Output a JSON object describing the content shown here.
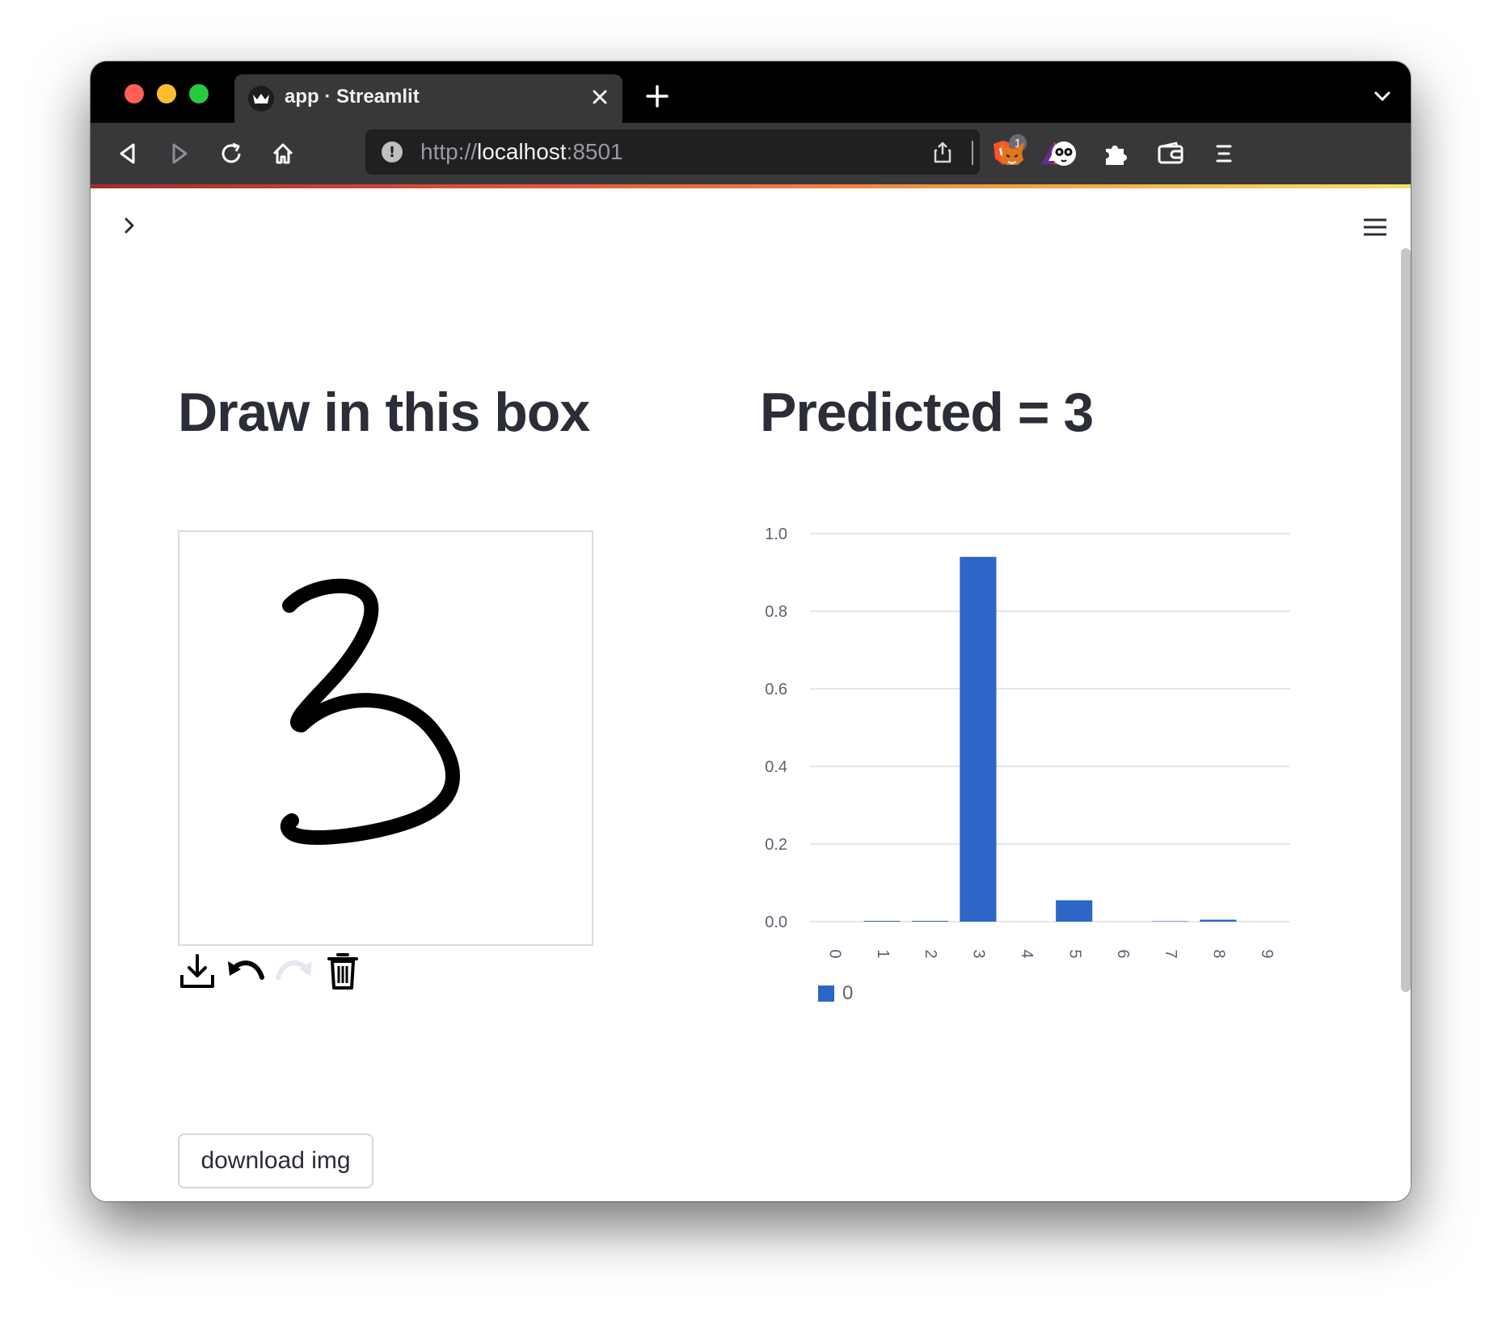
{
  "browser": {
    "tab_title": "app · Streamlit",
    "url_scheme": "http://",
    "url_host": "localhost",
    "url_port": ":8501",
    "shields_badge": "1"
  },
  "main": {
    "left_heading": "Draw in this box",
    "right_heading": "Predicted = 3",
    "download_button": "download img",
    "canvas_tools": [
      "download-icon",
      "undo-icon",
      "redo-icon",
      "trash-icon"
    ]
  },
  "colors": {
    "accent": "#2d66c6",
    "text": "#2b2d38"
  },
  "chart_data": {
    "type": "bar",
    "categories": [
      "0",
      "1",
      "2",
      "3",
      "4",
      "5",
      "6",
      "7",
      "8",
      "9"
    ],
    "series": [
      {
        "name": "0",
        "values": [
          0.0,
          0.002,
          0.002,
          0.94,
          0.0,
          0.055,
          0.0,
          0.001,
          0.005,
          0.0
        ]
      }
    ],
    "yticks": [
      "0.0",
      "0.2",
      "0.4",
      "0.6",
      "0.8",
      "1.0"
    ],
    "ylim": [
      0,
      1.0
    ],
    "grid": true,
    "legend_position": "bottom-left",
    "xlabel": "",
    "ylabel": ""
  }
}
